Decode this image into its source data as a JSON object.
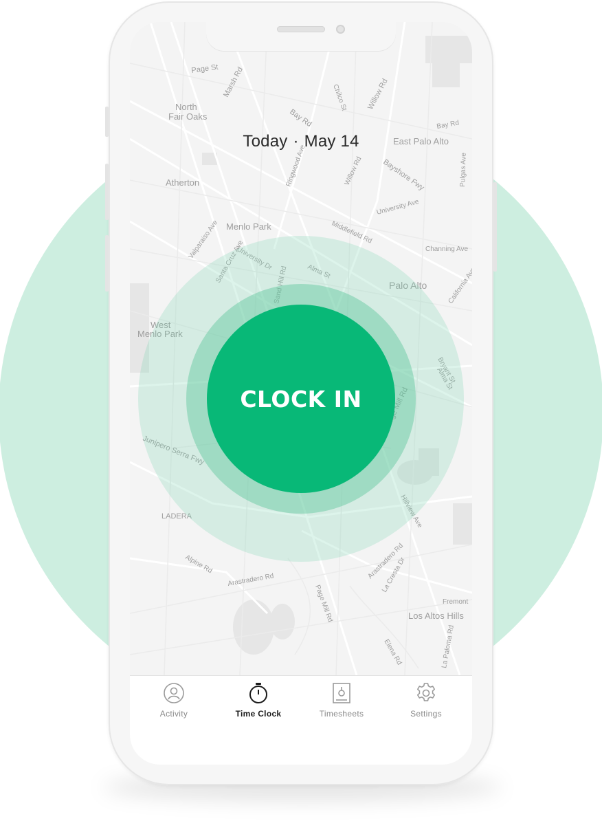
{
  "colors": {
    "accent": "#08b877",
    "background_circle": "#cdeee0",
    "map": "#f4f4f4"
  },
  "header": {
    "day": "Today",
    "separator": "·",
    "date": "May 14"
  },
  "map": {
    "labels": [
      "Page St",
      "Marsh Rd",
      "North",
      "Fair Oaks",
      "Bay Rd",
      "Willow Rd",
      "Chilco St",
      "Bay Rd",
      "East Palo Alto",
      "Atherton",
      "Ringwood Ave",
      "Willow Rd",
      "Bayshore Fwy",
      "Pulgas Ave",
      "University Ave",
      "Menlo Park",
      "Valparaiso Ave",
      "Santa Cruz Ave",
      "University Dr",
      "Middlefield Rd",
      "Channing Ave",
      "Alma St",
      "Palo Alto",
      "California Ave",
      "Sand Hill Rd",
      "West",
      "Menlo Park",
      "Bryant St",
      "Alma St",
      "Page Mill Rd",
      "Junipero Serra Fwy",
      "LADERA",
      "Hillview Ave",
      "Alpine Rd",
      "Arastradero Rd",
      "Arastradero Rd",
      "La Cresta Dr",
      "Page Mill Rd",
      "Fremont",
      "Los Altos Hills",
      "La Paloma Rd",
      "Elena Rd"
    ]
  },
  "main": {
    "clock_button_label": "CLOCK IN"
  },
  "tabbar": {
    "items": [
      {
        "label": "Activity",
        "icon": "activity-icon",
        "active": false
      },
      {
        "label": "Time Clock",
        "icon": "stopwatch-icon",
        "active": true
      },
      {
        "label": "Timesheets",
        "icon": "timesheet-icon",
        "active": false
      },
      {
        "label": "Settings",
        "icon": "gear-icon",
        "active": false
      }
    ]
  }
}
